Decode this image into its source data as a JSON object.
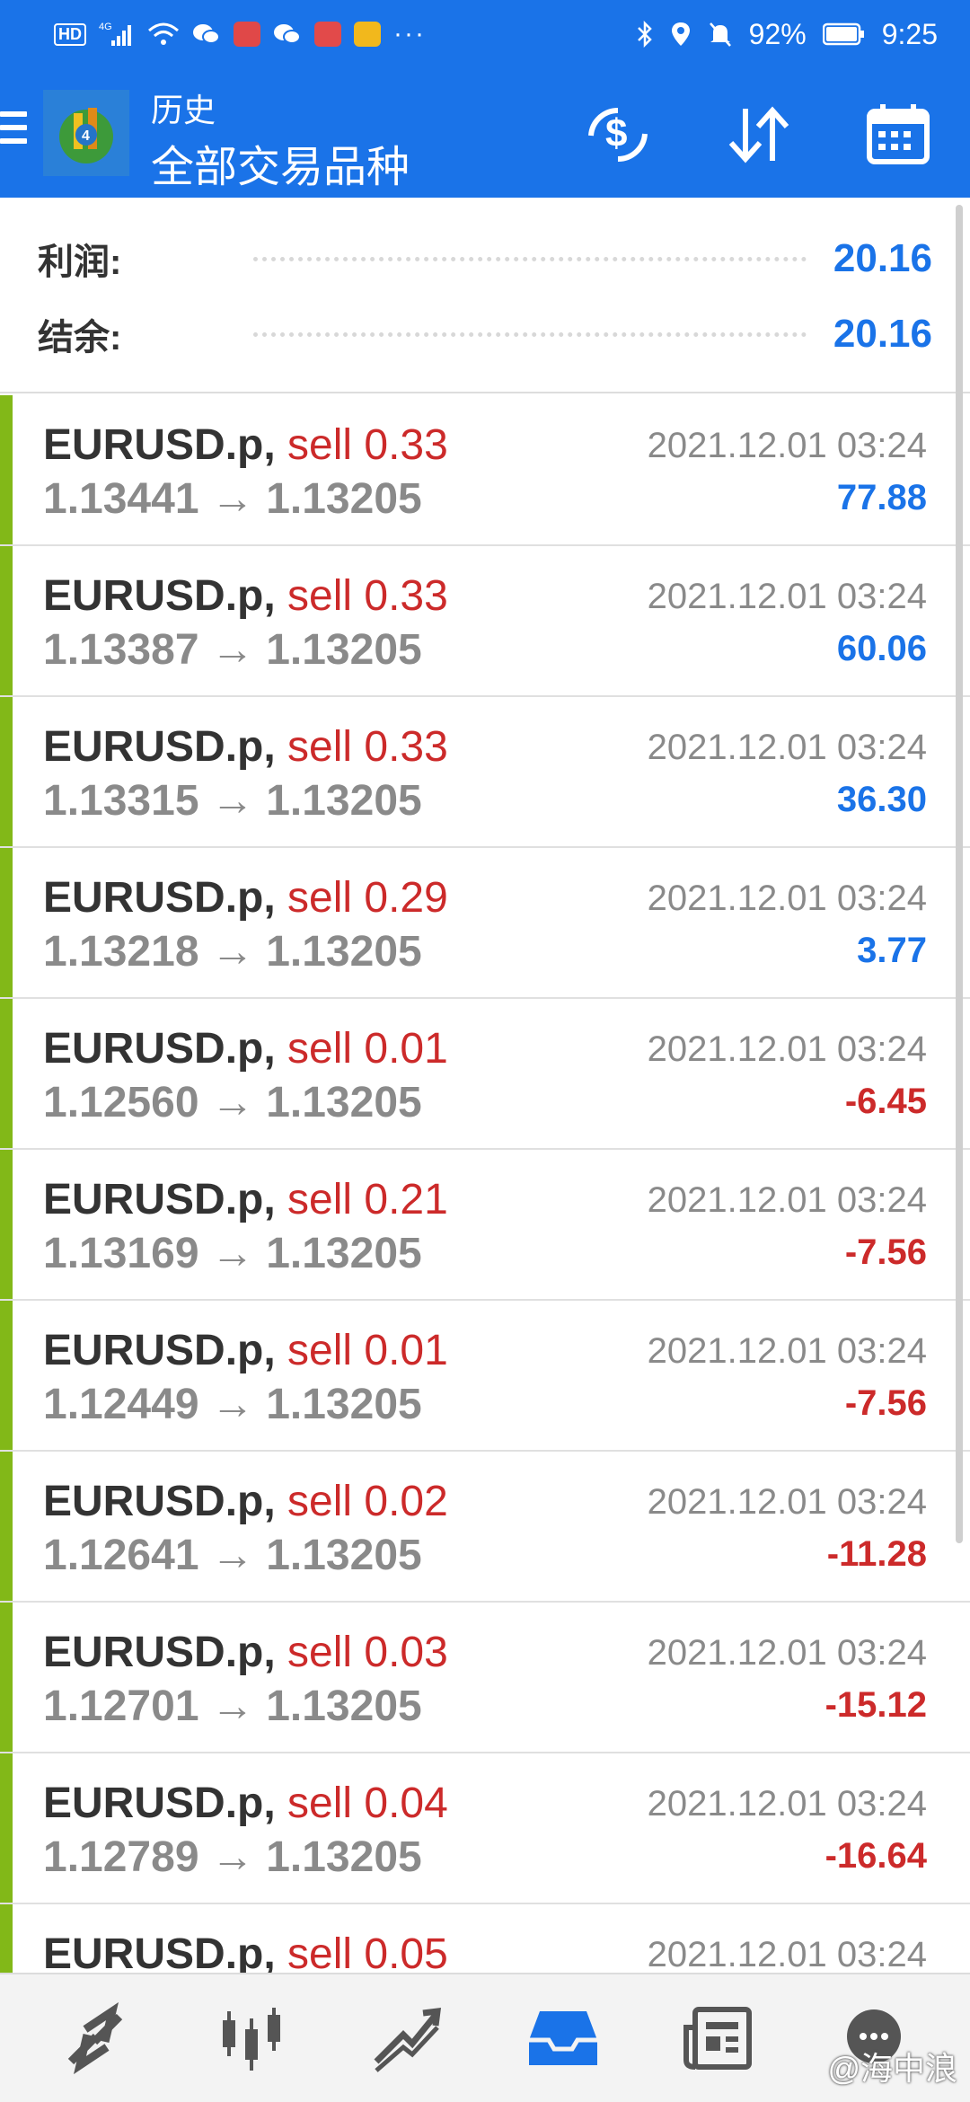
{
  "status_bar": {
    "network": "4G",
    "battery": "92%",
    "time": "9:25",
    "more": "···"
  },
  "app_bar": {
    "title": "历史",
    "subtitle": "全部交易品种",
    "icons": [
      "menu-icon",
      "currency-exchange-icon",
      "sort-icon",
      "calendar-icon"
    ]
  },
  "summary": {
    "profit_label": "利润:",
    "profit_value": "20.16",
    "balance_label": "结余:",
    "balance_value": "20.16"
  },
  "trades": [
    {
      "symbol": "EURUSD.p,",
      "type": "sell 0.33",
      "open": "1.13441",
      "close": "1.13205",
      "time": "2021.12.01 03:24",
      "profit": "77.88",
      "positive": true
    },
    {
      "symbol": "EURUSD.p,",
      "type": "sell 0.33",
      "open": "1.13387",
      "close": "1.13205",
      "time": "2021.12.01 03:24",
      "profit": "60.06",
      "positive": true
    },
    {
      "symbol": "EURUSD.p,",
      "type": "sell 0.33",
      "open": "1.13315",
      "close": "1.13205",
      "time": "2021.12.01 03:24",
      "profit": "36.30",
      "positive": true
    },
    {
      "symbol": "EURUSD.p,",
      "type": "sell 0.29",
      "open": "1.13218",
      "close": "1.13205",
      "time": "2021.12.01 03:24",
      "profit": "3.77",
      "positive": true
    },
    {
      "symbol": "EURUSD.p,",
      "type": "sell 0.01",
      "open": "1.12560",
      "close": "1.13205",
      "time": "2021.12.01 03:24",
      "profit": "-6.45",
      "positive": false
    },
    {
      "symbol": "EURUSD.p,",
      "type": "sell 0.21",
      "open": "1.13169",
      "close": "1.13205",
      "time": "2021.12.01 03:24",
      "profit": "-7.56",
      "positive": false
    },
    {
      "symbol": "EURUSD.p,",
      "type": "sell 0.01",
      "open": "1.12449",
      "close": "1.13205",
      "time": "2021.12.01 03:24",
      "profit": "-7.56",
      "positive": false
    },
    {
      "symbol": "EURUSD.p,",
      "type": "sell 0.02",
      "open": "1.12641",
      "close": "1.13205",
      "time": "2021.12.01 03:24",
      "profit": "-11.28",
      "positive": false
    },
    {
      "symbol": "EURUSD.p,",
      "type": "sell 0.03",
      "open": "1.12701",
      "close": "1.13205",
      "time": "2021.12.01 03:24",
      "profit": "-15.12",
      "positive": false
    },
    {
      "symbol": "EURUSD.p,",
      "type": "sell 0.04",
      "open": "1.12789",
      "close": "1.13205",
      "time": "2021.12.01 03:24",
      "profit": "-16.64",
      "positive": false
    },
    {
      "symbol": "EURUSD.p,",
      "type": "sell 0.05",
      "open": "",
      "close": "",
      "time": "2021.12.01 03:24",
      "profit": "",
      "positive": false
    }
  ],
  "arrow": "→",
  "bottom_nav": {
    "items": [
      "quotes-icon",
      "chart-candles-icon",
      "trade-icon",
      "history-icon",
      "news-icon",
      "chat-icon"
    ],
    "active": "history-icon"
  },
  "watermark": "@海中浪",
  "colors": {
    "primary": "#1a73e8",
    "sell": "#cc2a2a",
    "row_marker": "#82b818"
  }
}
